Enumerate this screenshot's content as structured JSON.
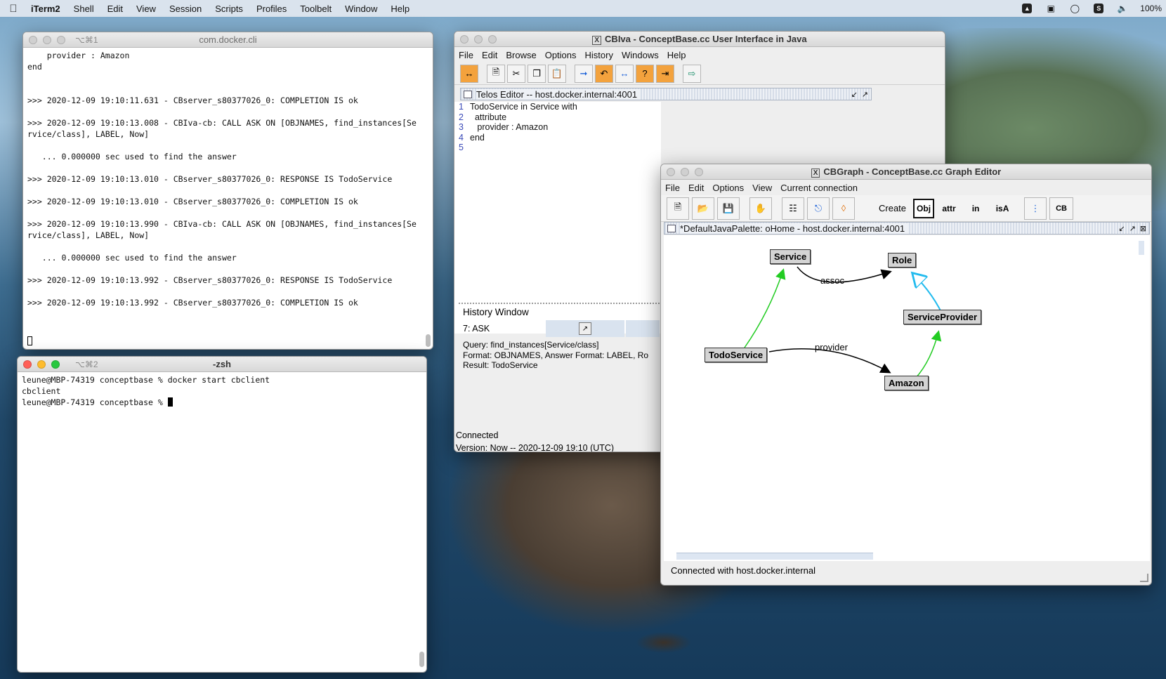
{
  "menubar": {
    "app": "iTerm2",
    "items": [
      "Shell",
      "Edit",
      "View",
      "Session",
      "Scripts",
      "Profiles",
      "Toolbelt",
      "Window",
      "Help"
    ],
    "battery": "100%"
  },
  "term1": {
    "tab_key": "⌥⌘1",
    "title": "com.docker.cli",
    "lines": [
      "    provider : Amazon",
      "end",
      "",
      "",
      ">>> 2020-12-09 19:10:11.631 - CBserver_s80377026_0: COMPLETION IS ok",
      "",
      ">>> 2020-12-09 19:10:13.008 - CBIva-cb: CALL ASK ON [OBJNAMES, find_instances[Se",
      "rvice/class], LABEL, Now]",
      "",
      "   ... 0.000000 sec used to find the answer",
      "",
      ">>> 2020-12-09 19:10:13.010 - CBserver_s80377026_0: RESPONSE IS TodoService",
      "",
      ">>> 2020-12-09 19:10:13.010 - CBserver_s80377026_0: COMPLETION IS ok",
      "",
      ">>> 2020-12-09 19:10:13.990 - CBIva-cb: CALL ASK ON [OBJNAMES, find_instances[Se",
      "rvice/class], LABEL, Now]",
      "",
      "   ... 0.000000 sec used to find the answer",
      "",
      ">>> 2020-12-09 19:10:13.992 - CBserver_s80377026_0: RESPONSE IS TodoService",
      "",
      ">>> 2020-12-09 19:10:13.992 - CBserver_s80377026_0: COMPLETION IS ok",
      ""
    ]
  },
  "term2": {
    "tab_key": "⌥⌘2",
    "title": "-zsh",
    "line1": "leune@MBP-74319 conceptbase % docker start cbclient",
    "line2": "cbclient",
    "prompt": "leune@MBP-74319 conceptbase % "
  },
  "cbiva": {
    "title": "CBIva - ConceptBase.cc User Interface in Java",
    "menu": [
      "File",
      "Edit",
      "Browse",
      "Options",
      "History",
      "Windows",
      "Help"
    ],
    "telos_title": "Telos Editor -- host.docker.internal:4001",
    "telos_lines": [
      {
        "num": "1",
        "code": "TodoService in Service with"
      },
      {
        "num": "2",
        "code": "  attribute"
      },
      {
        "num": "3",
        "code": "   provider : Amazon"
      },
      {
        "num": "4",
        "code": "end"
      },
      {
        "num": "5",
        "code": ""
      }
    ],
    "history_title": "History Window",
    "history_entry": "7:  ASK",
    "query": "Query: find_instances[Service/class]",
    "format": "Format: OBJNAMES, Answer Format: LABEL, Ro",
    "result": "Result: TodoService",
    "status": "Connected",
    "version": "Version: Now -- 2020-12-09 19:10 (UTC)"
  },
  "cbgraph": {
    "title": "CBGraph - ConceptBase.cc Graph Editor",
    "menu": [
      "File",
      "Edit",
      "Options",
      "View",
      "Current connection"
    ],
    "create_label": "Create",
    "obj_label": "Obj",
    "attr_label": "attr",
    "in_label": "in",
    "isa_label": "isA",
    "cb_label": "CB",
    "palette_title": "*DefaultJavaPalette: oHome - host.docker.internal:4001",
    "nodes": {
      "service": "Service",
      "role": "Role",
      "service_provider": "ServiceProvider",
      "todo_service": "TodoService",
      "amazon": "Amazon"
    },
    "edge_labels": {
      "assoc": "assoc",
      "provider": "provider"
    },
    "status": "Connected with host.docker.internal",
    "colors": {
      "instance_edge": "#22cc22",
      "isa_edge": "#22bbee",
      "attr_edge": "#000000"
    }
  }
}
